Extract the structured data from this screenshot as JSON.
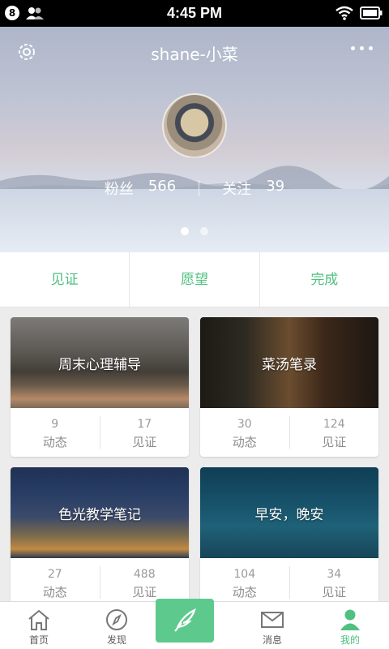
{
  "status_bar": {
    "time": "4:45 PM",
    "notification_count": "8"
  },
  "profile": {
    "name": "shane-小菜",
    "followers_label": "粉丝",
    "followers_count": "566",
    "following_label": "关注",
    "following_count": "39"
  },
  "tabs": [
    "见证",
    "愿望",
    "完成"
  ],
  "cards": [
    {
      "title": "周末心理辅导",
      "dynamics": "9",
      "dynamics_label": "动态",
      "witness": "17",
      "witness_label": "见证"
    },
    {
      "title": "菜汤笔录",
      "dynamics": "30",
      "dynamics_label": "动态",
      "witness": "124",
      "witness_label": "见证"
    },
    {
      "title": "色光教学笔记",
      "dynamics": "27",
      "dynamics_label": "动态",
      "witness": "488",
      "witness_label": "见证"
    },
    {
      "title": "早安，晚安",
      "dynamics": "104",
      "dynamics_label": "动态",
      "witness": "34",
      "witness_label": "见证"
    }
  ],
  "bottom_nav": {
    "home": "首页",
    "discover": "发现",
    "messages": "消息",
    "mine": "我的"
  },
  "colors": {
    "accent": "#4fc080",
    "compose": "#5ec98c"
  }
}
